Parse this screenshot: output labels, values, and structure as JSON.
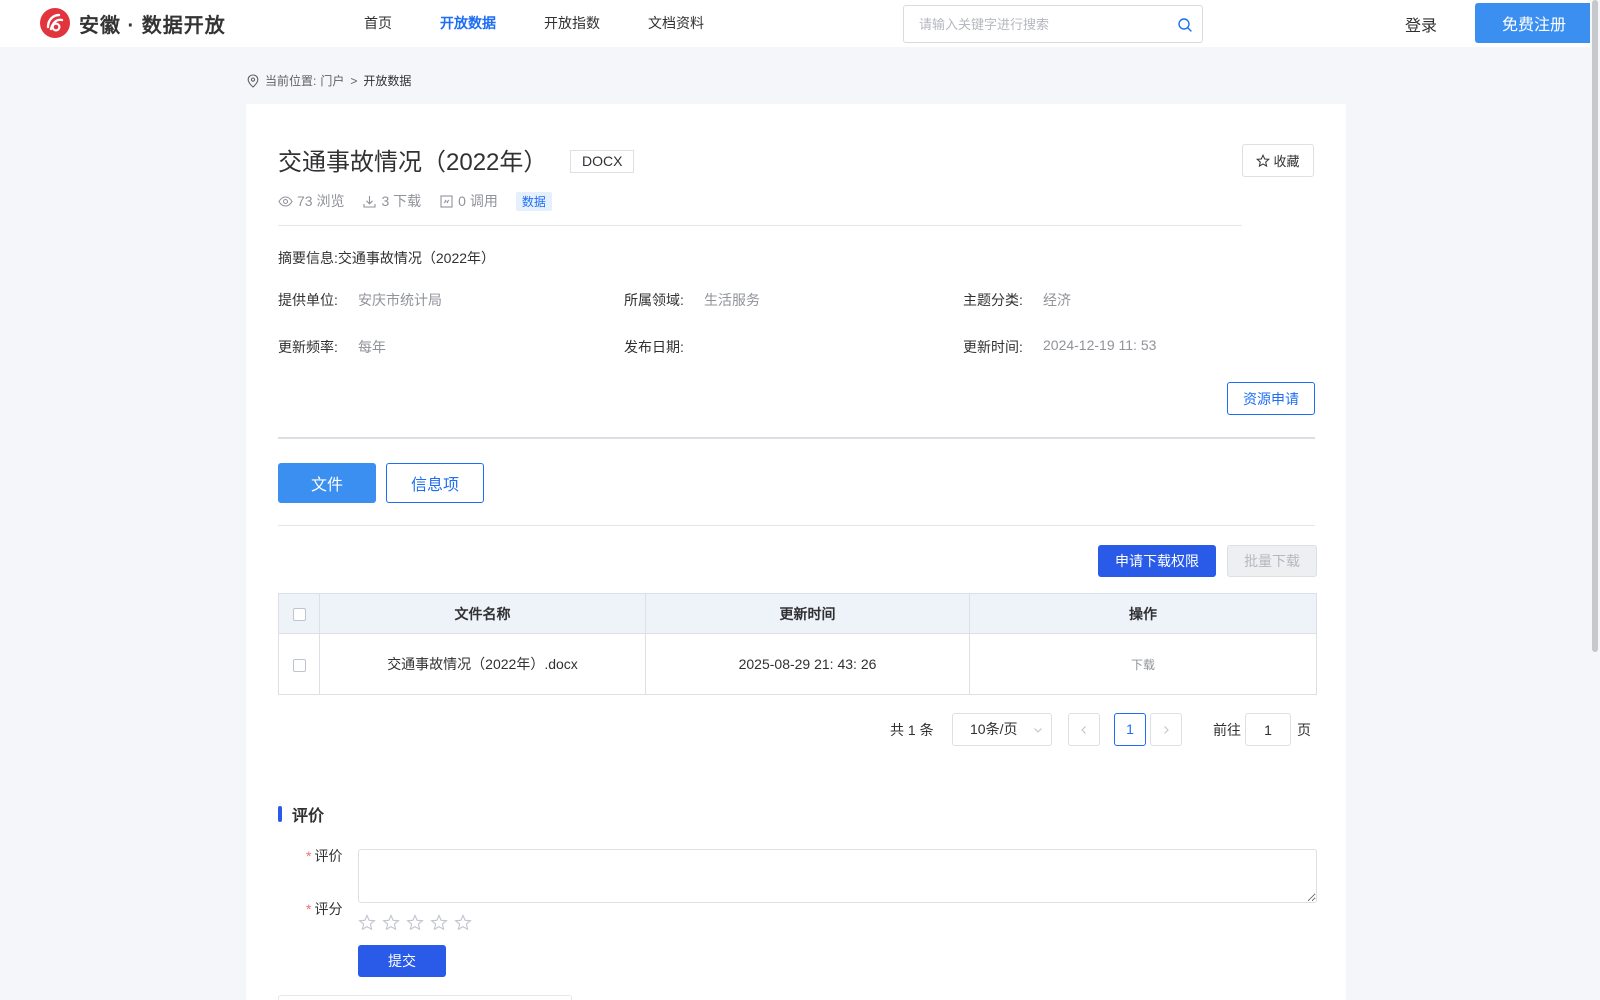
{
  "header": {
    "logo_text": "安徽 · 数据开放",
    "nav": [
      "首页",
      "开放数据",
      "开放指数",
      "文档资料"
    ],
    "search_placeholder": "请输入关键字进行搜索",
    "login_label": "登录",
    "register_label": "免费注册",
    "brand_color": "#1d6ef4",
    "logo_color": "#e2343c"
  },
  "breadcrumb": {
    "prefix": "当前位置:",
    "home": "门户",
    "separator": ">",
    "current": "开放数据"
  },
  "dataset": {
    "title": "交通事故情况（2022年）",
    "format": "DOCX",
    "favorite_label": "收藏",
    "views": "73 浏览",
    "downloads": "3 下载",
    "calls": "0 调用",
    "type_badge": "数据",
    "summary_label": "摘要信息:",
    "summary_value": "交通事故情况（2022年）",
    "meta": {
      "provider_label": "提供单位:",
      "provider_value": "安庆市统计局",
      "domain_label": "所属领域:",
      "domain_value": "生活服务",
      "topic_label": "主题分类:",
      "topic_value": "经济",
      "frequency_label": "更新频率:",
      "frequency_value": "每年",
      "publish_label": "发布日期:",
      "publish_value": "",
      "updated_label": "更新时间:",
      "updated_value": "2024-12-19 11: 53"
    },
    "apply_resource_label": "资源申请"
  },
  "tabs": {
    "file": "文件",
    "info": "信息项"
  },
  "actions": {
    "apply_download": "申请下载权限",
    "batch_download": "批量下载"
  },
  "table": {
    "headers": [
      "文件名称",
      "更新时间",
      "操作"
    ],
    "rows": [
      {
        "name": "交通事故情况（2022年）.docx",
        "updated": "2025-08-29 21: 43: 26",
        "action": "下载"
      }
    ]
  },
  "pagination": {
    "total": "共 1 条",
    "page_size": "10条/页",
    "current_page": "1",
    "goto_label": "前往",
    "goto_value": "1",
    "goto_suffix": "页"
  },
  "review": {
    "section_title": "评价",
    "comment_label": "评价",
    "rating_label": "评分",
    "required_mark": "*",
    "rating": 0,
    "max_rating": 5,
    "submit_label": "提交"
  }
}
